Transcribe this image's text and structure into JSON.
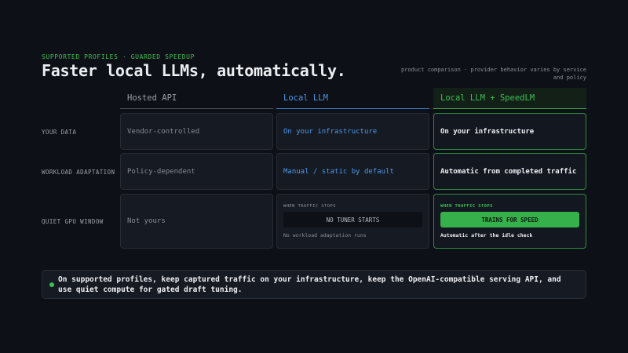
{
  "header": {
    "eyebrow": "SUPPORTED PROFILES · GUARDED SPEEDUP",
    "title": "Faster local LLMs, automatically.",
    "note": "product comparison · provider behavior varies by service and policy"
  },
  "columns": {
    "hosted": "Hosted API",
    "local": "Local LLM",
    "speed": "Local LLM + SpeedLM"
  },
  "rows": {
    "data": {
      "label": "YOUR DATA",
      "hosted": "Vendor-controlled",
      "local": "On your infrastructure",
      "speed": "On your infrastructure"
    },
    "workload": {
      "label": "WORKLOAD ADAPTATION",
      "hosted": "Policy-dependent",
      "local": "Manual / static by default",
      "speed": "Automatic from completed traffic"
    },
    "gpu": {
      "label": "QUIET GPU WINDOW",
      "hosted": "Not yours",
      "local": {
        "mini_label": "WHEN TRAFFIC STOPS",
        "pill": "NO TUNER STARTS",
        "foot": "No workload adaptation runs"
      },
      "speed": {
        "mini_label": "WHEN TRAFFIC STOPS",
        "pill": "TRAINS FOR SPEED",
        "foot": "Automatic after the idle check"
      }
    }
  },
  "banner": {
    "text": "On supported profiles, keep captured traffic on your infrastructure, keep the OpenAI-compatible serving API, and use quiet compute for gated draft tuning."
  },
  "colors": {
    "background": "#0d1016",
    "accent_green": "#3fbf55",
    "accent_blue": "#4d97e8"
  }
}
